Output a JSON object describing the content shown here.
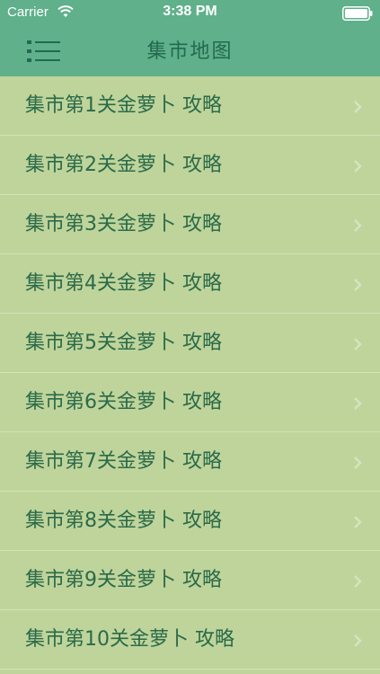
{
  "status_bar": {
    "carrier": "Carrier",
    "time": "3:38 PM",
    "wifi_icon": "wifi-icon",
    "battery_icon": "battery-icon"
  },
  "nav_bar": {
    "title": "集市地图",
    "menu_icon": "menu-list-icon"
  },
  "list": {
    "items": [
      {
        "label": "集市第1关金萝卜 攻略"
      },
      {
        "label": "集市第2关金萝卜 攻略"
      },
      {
        "label": "集市第3关金萝卜 攻略"
      },
      {
        "label": "集市第4关金萝卜 攻略"
      },
      {
        "label": "集市第5关金萝卜 攻略"
      },
      {
        "label": "集市第6关金萝卜 攻略"
      },
      {
        "label": "集市第7关金萝卜 攻略"
      },
      {
        "label": "集市第8关金萝卜 攻略"
      },
      {
        "label": "集市第9关金萝卜 攻略"
      },
      {
        "label": "集市第10关金萝卜 攻略"
      }
    ],
    "chevron_icon": "chevron-right-icon"
  },
  "colors": {
    "header_bg": "#5fb08b",
    "list_bg": "#bfd49a",
    "text": "#2a6a4a",
    "separator": "#d4e2bb"
  }
}
